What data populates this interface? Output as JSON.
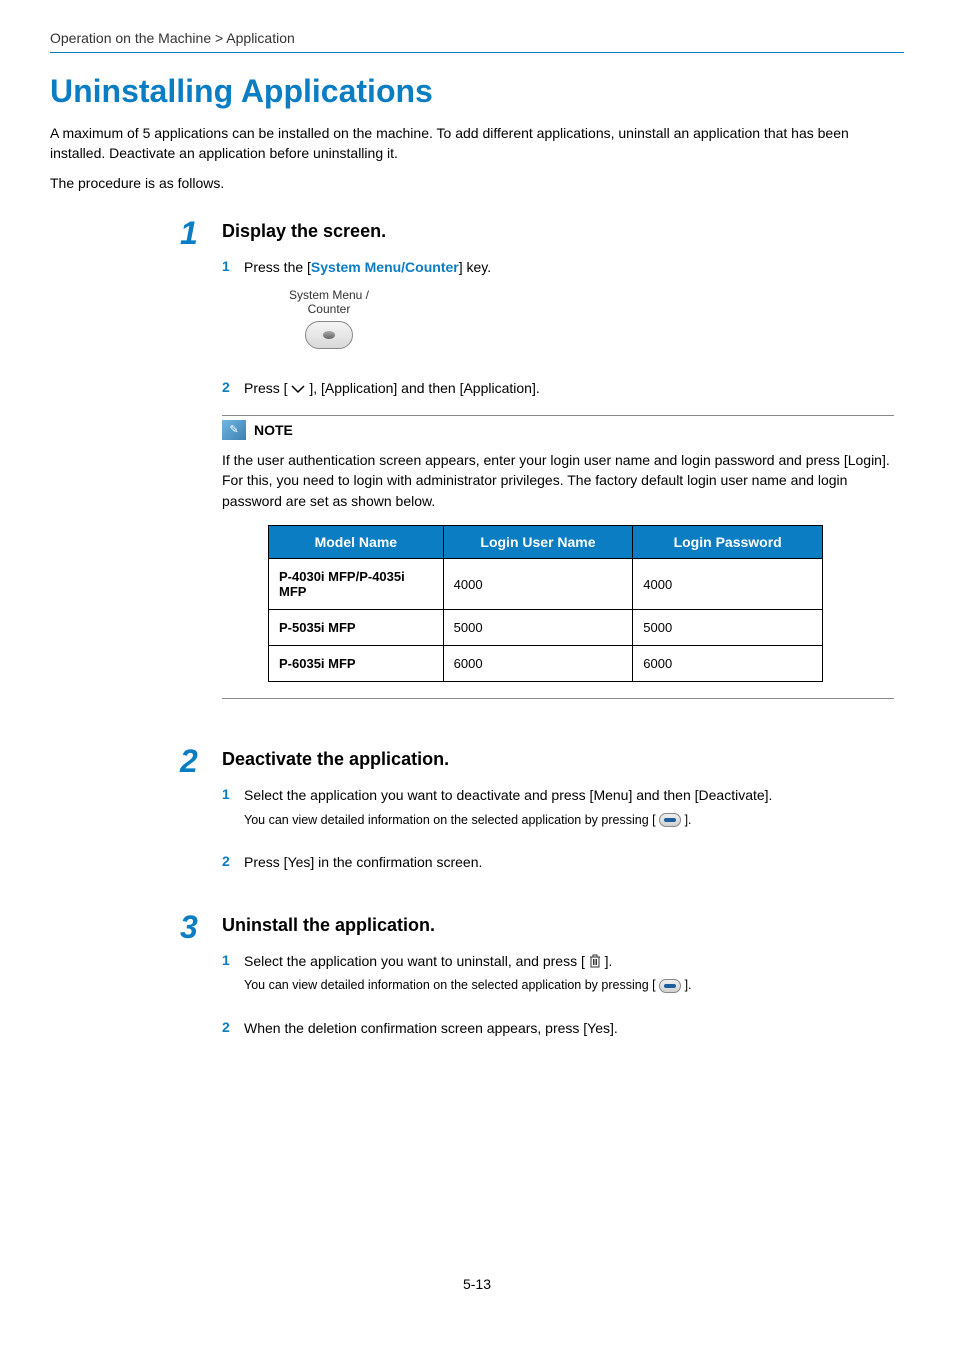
{
  "breadcrumb": "Operation on the Machine > Application",
  "page_title": "Uninstalling Applications",
  "intro": "A maximum of 5 applications can be installed on the machine. To add different applications, uninstall an application that has been installed. Deactivate an application before uninstalling it.",
  "procedure_is": "The procedure is as follows.",
  "steps": [
    {
      "number": "1",
      "title": "Display the screen.",
      "substeps": [
        {
          "n": "1",
          "prefix": "Press the [",
          "key": "System Menu/Counter",
          "suffix": "] key.",
          "button_graphic": {
            "line1": "System Menu /",
            "line2": "Counter"
          }
        },
        {
          "n": "2",
          "prefix": "Press [",
          "mid": "], [Application] and then [Application]."
        }
      ],
      "note": {
        "label": "NOTE",
        "text": "If the user authentication screen appears, enter your login user name and login password and press [Login]. For this, you need to login with administrator privileges. The factory default login user name and login password are set as shown below.",
        "table": {
          "headers": [
            "Model Name",
            "Login User Name",
            "Login Password"
          ],
          "rows": [
            [
              "P-4030i MFP/P-4035i MFP",
              "4000",
              "4000"
            ],
            [
              "P-5035i MFP",
              "5000",
              "5000"
            ],
            [
              "P-6035i MFP",
              "6000",
              "6000"
            ]
          ]
        }
      }
    },
    {
      "number": "2",
      "title": "Deactivate the application.",
      "substeps": [
        {
          "n": "1",
          "text": "Select the application you want to deactivate and press [Menu] and then [Deactivate].",
          "detail_prefix": "You can view detailed information on the selected application by pressing [",
          "detail_suffix": "]."
        },
        {
          "n": "2",
          "text": "Press [Yes] in the confirmation screen."
        }
      ]
    },
    {
      "number": "3",
      "title": "Uninstall the application.",
      "substeps": [
        {
          "n": "1",
          "prefix": "Select the application you want to uninstall, and press [",
          "suffix": "].",
          "detail_prefix": "You can view detailed information on the selected application by pressing [",
          "detail_suffix": "]."
        },
        {
          "n": "2",
          "text": "When the deletion confirmation screen appears, press [Yes]."
        }
      ]
    }
  ],
  "page_number": "5-13"
}
